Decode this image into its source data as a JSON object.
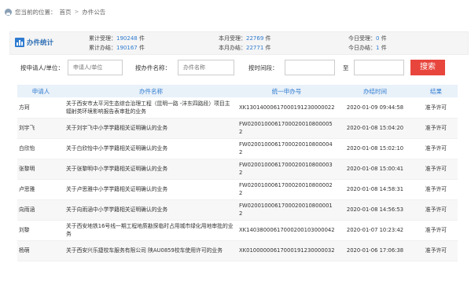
{
  "breadcrumb": {
    "prefix": "您当前的位置：",
    "home": "首页",
    "separator": ">",
    "current": "办件公告"
  },
  "stats": {
    "title": "办件统计",
    "total_accepted_label": "累计受理：",
    "total_accepted": "190248",
    "total_accepted_unit": "件",
    "total_done_label": "累计办结：",
    "total_done": "190167",
    "total_done_unit": "件",
    "month_accepted_label": "本月受理：",
    "month_accepted": "22769",
    "month_accepted_unit": "件",
    "month_done_label": "本月办结：",
    "month_done": "22771",
    "month_done_unit": "件",
    "today_accepted_label": "今日受理：",
    "today_accepted": "0",
    "today_accepted_unit": "件",
    "today_done_label": "今日办结：",
    "today_done": "1",
    "today_done_unit": "件"
  },
  "filter": {
    "applicant_label": "按申请人/单位：",
    "applicant_placeholder": "申请人/单位",
    "item_label": "按办件名称：",
    "item_placeholder": "办件名称",
    "time_label": "按时间段：",
    "to_label": "至",
    "search_label": "搜索"
  },
  "table": {
    "headers": [
      "申请人",
      "办件名称",
      "统一申办号",
      "办结时间",
      "结果"
    ],
    "rows": [
      {
        "applicant": "方珂",
        "title": "关于西安市太平河生态综合治理工程（昆明一路 -沣东四路段）项目主辐射类环境影响报告表审批的业务",
        "code": "XK13014000617000191230000022",
        "time": "2020-01-09 09:44:58",
        "result": "准予许可"
      },
      {
        "applicant": "刘宇飞",
        "title": "关于刘宇飞中小学学籍相关证明确认的业务",
        "code": "FW02001000617000200108000052",
        "time": "2020-01-08 15:04:20",
        "result": "准予许可"
      },
      {
        "applicant": "白欣怡",
        "title": "关于白欣怡中小学学籍相关证明确认的业务",
        "code": "FW02001000617000200108000042",
        "time": "2020-01-08 15:02:10",
        "result": "准予许可"
      },
      {
        "applicant": "张黎明",
        "title": "关于张黎明中小学学籍相关证明确认的业务",
        "code": "FW02001000617000200108000032",
        "time": "2020-01-08 15:00:41",
        "result": "准予许可"
      },
      {
        "applicant": "卢思雅",
        "title": "关于卢思雅中小学学籍相关证明确认的业务",
        "code": "FW02001000617000200108000022",
        "time": "2020-01-08 14:58:31",
        "result": "准予许可"
      },
      {
        "applicant": "向雨涵",
        "title": "关于向雨涵中小学学籍相关证明确认的业务",
        "code": "FW02001000617000200108000012",
        "time": "2020-01-08 14:56:53",
        "result": "准予许可"
      },
      {
        "applicant": "刘黎",
        "title": "关于西安地铁16号线一期工程地质勘探临时占用城市绿化用地审批的业务",
        "code": "XK14038000617000200103000042",
        "time": "2020-01-07 10:23:42",
        "result": "准予许可"
      },
      {
        "applicant": "杨萌",
        "title": "关于西安兴乐捷校车服务有限公司 陕AU0859校车使用许可的业务",
        "code": "XK01000000617000191230000032",
        "time": "2020-01-06 17:06:38",
        "result": "准予许可"
      }
    ]
  }
}
